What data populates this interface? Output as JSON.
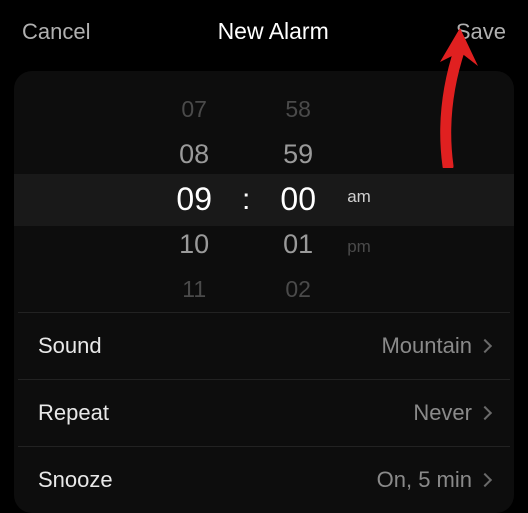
{
  "header": {
    "cancel": "Cancel",
    "title": "New Alarm",
    "save": "Save"
  },
  "picker": {
    "hours": {
      "far_prev": "07",
      "prev": "08",
      "selected": "09",
      "next": "10",
      "far_next": "11"
    },
    "minutes": {
      "far_prev": "58",
      "prev": "59",
      "selected": "00",
      "next": "01",
      "far_next": "02"
    },
    "colon": ":",
    "ampm": {
      "am": "am",
      "pm": "pm",
      "selected": "am"
    }
  },
  "settings": {
    "sound": {
      "label": "Sound",
      "value": "Mountain"
    },
    "repeat": {
      "label": "Repeat",
      "value": "Never"
    },
    "snooze": {
      "label": "Snooze",
      "value": "On, 5 min"
    }
  }
}
